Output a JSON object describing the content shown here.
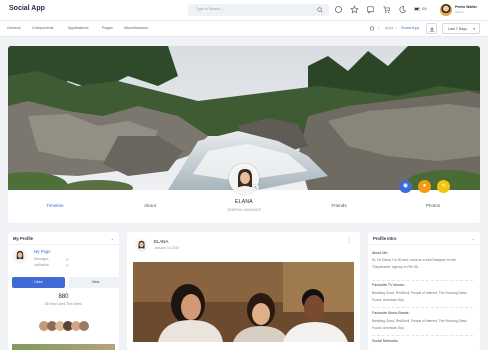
{
  "app": {
    "title": "Social App"
  },
  "search": {
    "placeholder": "Type to Search..."
  },
  "header": {
    "language": "EN",
    "user_name": "Pedro Walter",
    "user_role": "Admin"
  },
  "nav": {
    "items": [
      "General",
      "Components",
      "Applications",
      "Pages",
      "Miscellaneous"
    ]
  },
  "breadcrumb": {
    "items": [
      "Apps",
      "Social App"
    ],
    "date_filter": "Last 7 Days"
  },
  "profile": {
    "name": "ELANA",
    "role": "GENERAL MANAGER",
    "tabs": [
      "Timeline",
      "About",
      "Friends",
      "Photos"
    ],
    "social_colors": {
      "button_1": "#3f6ad8",
      "button_2": "#f39c12",
      "button_3": "#f1c40f"
    }
  },
  "my_profile": {
    "title": "My Profile",
    "page_name": "My Page",
    "messages_label": "Messages",
    "notifications_label": "notification",
    "likes_btn": "Likes",
    "view_btn": "View",
    "likes_count": "880",
    "likes_caption": "88 New Likes This Week"
  },
  "post": {
    "author": "ELANA",
    "date": "January 14,2019"
  },
  "profile_intro": {
    "title": "Profile Intro",
    "about_label": "About Me :",
    "about_text": "Hi, I'm Elana, I'm 30 and I work as a web Designer for the \"Daydreams\" Agency in Pier 56.",
    "tv_label": "Favourite TV shows :",
    "tv_text": "Breaking Good, RedDevil, People of Interest, The Running Dead, Found, American Guy.",
    "music_label": "Favourite Music Bands :",
    "music_text": "Breaking Good, RedDevil, People of Interest, The Running Dead, Found, American Guy.",
    "social_label": "Social Networks"
  },
  "colors": {
    "accent": "#3f6ad8",
    "background": "#f0f2f6"
  }
}
